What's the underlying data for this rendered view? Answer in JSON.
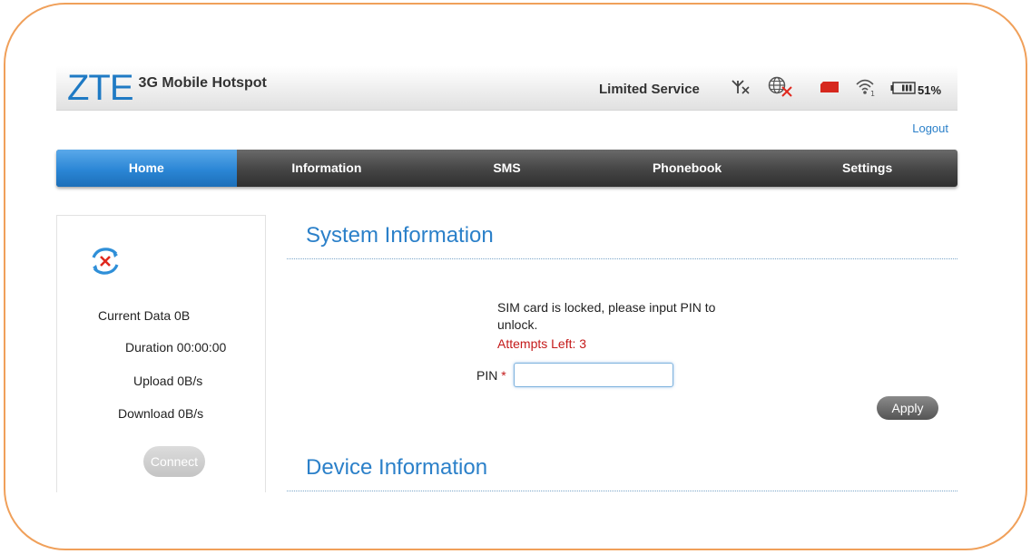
{
  "header": {
    "brand": "ZTE",
    "product": "3G Mobile Hotspot",
    "network_status": "Limited Service",
    "battery_percent": "51%",
    "icons": [
      "no-signal-icon",
      "internet-disconnected-icon",
      "sim-card-icon",
      "wifi-icon",
      "battery-icon"
    ]
  },
  "logout_label": "Logout",
  "nav": {
    "items": [
      {
        "label": "Home",
        "active": true
      },
      {
        "label": "Information",
        "active": false
      },
      {
        "label": "SMS",
        "active": false
      },
      {
        "label": "Phonebook",
        "active": false
      },
      {
        "label": "Settings",
        "active": false
      }
    ]
  },
  "sidebar": {
    "icon": "disconnected-sync-icon",
    "current_data": "Current Data 0B",
    "duration": "Duration 00:00:00",
    "upload": "Upload 0B/s",
    "download": "Download 0B/s",
    "connect_label": "Connect"
  },
  "system_info": {
    "title": "System Information",
    "message": "SIM card is locked, please input PIN to unlock.",
    "attempts": "Attempts Left: 3",
    "pin_label": "PIN",
    "required_mark": "*",
    "pin_value": "",
    "apply_label": "Apply"
  },
  "device_info": {
    "title": "Device Information"
  },
  "colors": {
    "frame": "#f0a05a",
    "accent": "#2b80c9",
    "nav_dark": "#474747",
    "error": "#c41a1a"
  }
}
